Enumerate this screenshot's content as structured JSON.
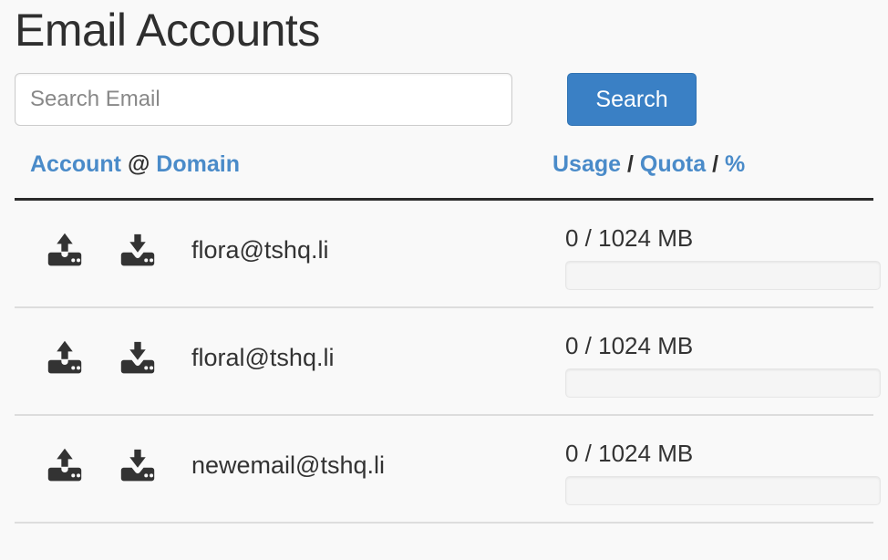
{
  "page": {
    "title": "Email Accounts"
  },
  "search": {
    "placeholder": "Search Email",
    "value": "",
    "button_label": "Search"
  },
  "table": {
    "headers": {
      "account": "Account",
      "at": "@",
      "domain": "Domain",
      "usage": "Usage",
      "sep1": "/",
      "quota": "Quota",
      "sep2": "/",
      "percent": "%"
    },
    "rows": [
      {
        "email": "flora@tshq.li",
        "usage_text": "0 / 1024 MB",
        "used_mb": 0,
        "quota_mb": 1024,
        "percent": 0,
        "upload_icon": "upload-icon",
        "download_icon": "download-icon"
      },
      {
        "email": "floral@tshq.li",
        "usage_text": "0 / 1024 MB",
        "used_mb": 0,
        "quota_mb": 1024,
        "percent": 0,
        "upload_icon": "upload-icon",
        "download_icon": "download-icon"
      },
      {
        "email": "newemail@tshq.li",
        "usage_text": "0 / 1024 MB",
        "used_mb": 0,
        "quota_mb": 1024,
        "percent": 0,
        "upload_icon": "upload-icon",
        "download_icon": "download-icon"
      }
    ]
  },
  "colors": {
    "link": "#4a8bc9",
    "button": "#3a80c5",
    "page_background": "#f9f9f9",
    "text": "#333333",
    "rule": "#2b2b2b",
    "row_divider": "#dddddd",
    "progress_track": "#f5f5f5"
  }
}
